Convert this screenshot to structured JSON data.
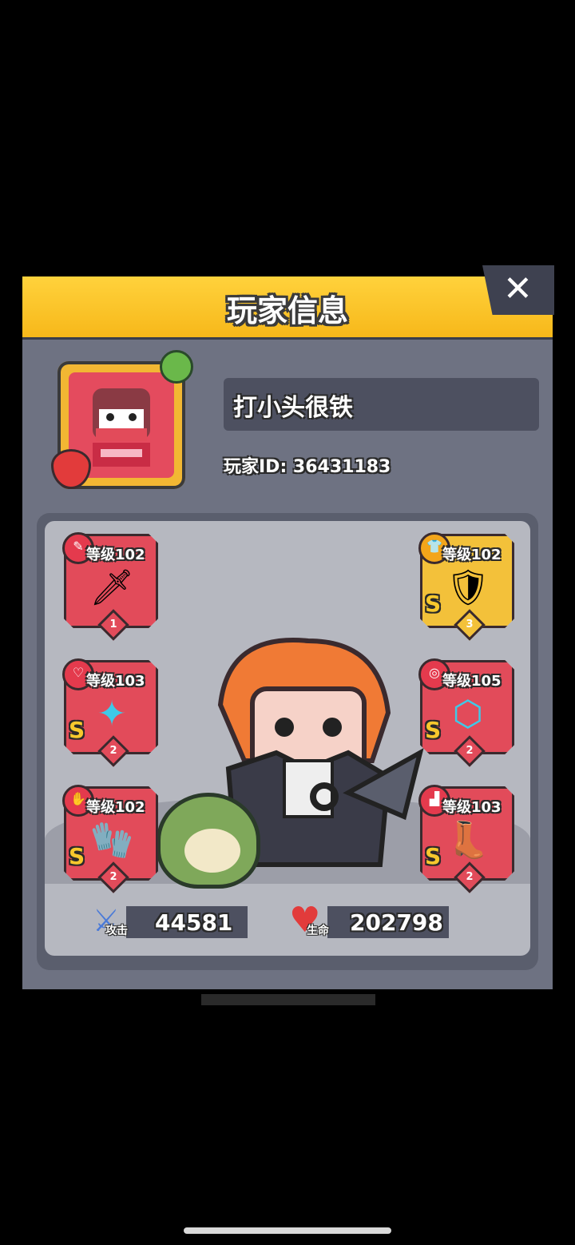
{
  "title": "玩家信息",
  "close_label": "✕",
  "player": {
    "name": "打小头很铁",
    "id_text": "玩家ID: 36431183"
  },
  "equipment": [
    {
      "level": "等级102",
      "grade": "",
      "stars": "1",
      "icon": "kunai-icon",
      "art": "🗡"
    },
    {
      "level": "等级103",
      "grade": "S",
      "stars": "2",
      "icon": "necklace-icon",
      "art": "✦"
    },
    {
      "level": "等级102",
      "grade": "S",
      "stars": "2",
      "icon": "glove-icon",
      "art": "🧤"
    },
    {
      "level": "等级102",
      "grade": "S",
      "stars": "3",
      "icon": "armor-icon",
      "art": "🛡"
    },
    {
      "level": "等级105",
      "grade": "S",
      "stars": "2",
      "icon": "belt-icon",
      "art": "⬡"
    },
    {
      "level": "等级103",
      "grade": "S",
      "stars": "2",
      "icon": "boots-icon",
      "art": "👢"
    }
  ],
  "stats": {
    "attack_label": "攻击",
    "attack_value": "44581",
    "hp_label": "生命",
    "hp_value": "202798"
  },
  "colors": {
    "title_bar": "#f7b81a",
    "panel": "#6e7282",
    "slot_red": "#e24b5a",
    "slot_gold": "#f3c13a"
  }
}
